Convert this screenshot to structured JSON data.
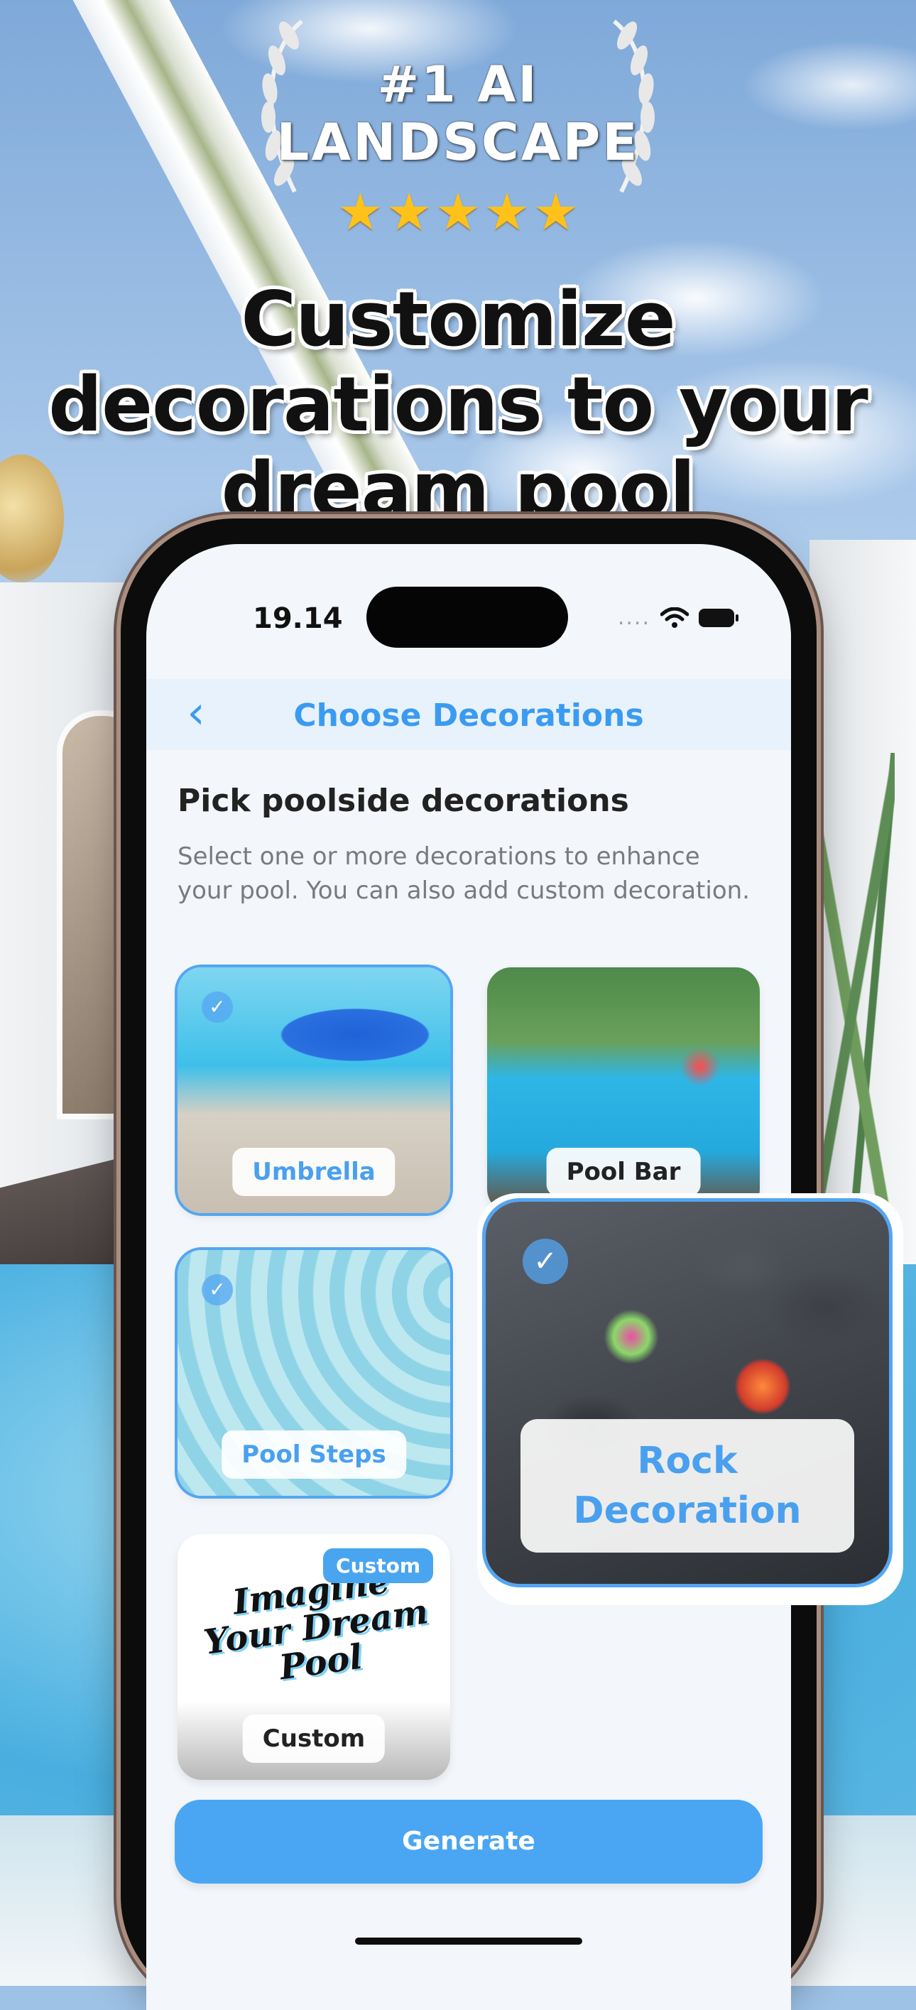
{
  "badge": {
    "line1": "#1 AI",
    "line2": "LANDSCAPE",
    "stars": [
      "★",
      "★",
      "★",
      "★",
      "★"
    ],
    "laurel_icon": "laurel-icon"
  },
  "headline": "Customize decorations to your dream pool",
  "status_bar": {
    "time": "19.14",
    "signal": "....",
    "icons": [
      "wifi-icon",
      "battery-icon"
    ]
  },
  "nav": {
    "back_icon": "chevron-left-icon",
    "back_glyph": "‹",
    "title": "Choose Decorations"
  },
  "section": {
    "title": "Pick poolside decorations",
    "description": "Select one or more decorations to enhance your pool. You can also add custom decoration."
  },
  "decorations": [
    {
      "label": "Umbrella",
      "selected": true
    },
    {
      "label": "Pool Bar",
      "selected": false
    },
    {
      "label": "Pool Steps",
      "selected": true
    },
    {
      "label": "Rock Decoration",
      "selected": true
    },
    {
      "label": "Custom",
      "selected": false,
      "tag": "Custom",
      "art_text": "Imagine Your Dream Pool"
    }
  ],
  "check_glyph": "✓",
  "generate_button": "Generate",
  "colors": {
    "accent": "#4aa6f2",
    "title_blue": "#3b9bf0",
    "text_dark": "#222222",
    "text_muted": "#777b80",
    "star": "#ffc21a"
  }
}
